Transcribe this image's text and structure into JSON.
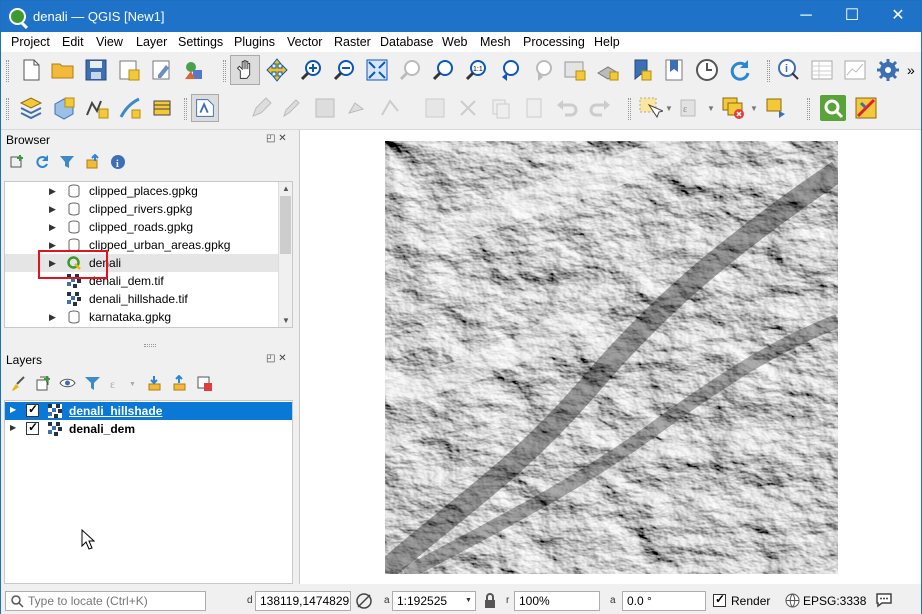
{
  "window": {
    "title": "denali — QGIS [New1]",
    "minimize": "─",
    "maximize": "☐",
    "close": "✕"
  },
  "menu": [
    "Project",
    "Edit",
    "View",
    "Layer",
    "Settings",
    "Plugins",
    "Vector",
    "Raster",
    "Database",
    "Web",
    "Mesh",
    "Processing",
    "Help"
  ],
  "toolbar_overflow": "»",
  "browser": {
    "title": "Browser",
    "items": [
      {
        "label": "clipped_places.gpkg",
        "icon": "database-icon"
      },
      {
        "label": "clipped_rivers.gpkg",
        "icon": "database-icon"
      },
      {
        "label": "clipped_roads.gpkg",
        "icon": "database-icon"
      },
      {
        "label": "clipped_urban_areas.gpkg",
        "icon": "database-icon"
      },
      {
        "label": "denali",
        "icon": "qgis-project-icon"
      },
      {
        "label": "denali_dem.tif",
        "icon": "raster-icon"
      },
      {
        "label": "denali_hillshade.tif",
        "icon": "raster-icon"
      },
      {
        "label": "karnataka.gpkg",
        "icon": "database-icon"
      }
    ]
  },
  "layers": {
    "title": "Layers",
    "items": [
      {
        "label": "denali_hillshade",
        "checked": true,
        "selected": true
      },
      {
        "label": "denali_dem",
        "checked": true,
        "selected": false
      }
    ]
  },
  "status": {
    "locate_placeholder": "Type to locate (Ctrl+K)",
    "coord_label": "d",
    "coordinate": "138119,1474829",
    "scale_label": "a",
    "scale": "1:192525",
    "magnifier_label": "r",
    "magnifier": "100%",
    "rotation_label": "a",
    "rotation": "0.0 °",
    "render_label": "Render",
    "crs": "EPSG:3338"
  },
  "colors": {
    "titlebar": "#1e73c8",
    "selection": "#0a78d7",
    "highlight_box": "#e0141e"
  }
}
